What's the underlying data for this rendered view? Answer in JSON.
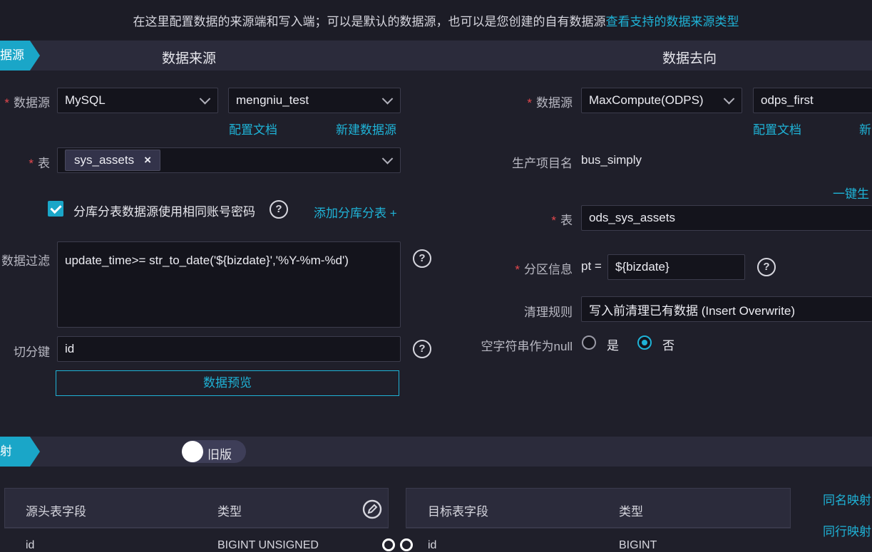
{
  "banner": {
    "text": "在这里配置数据的来源端和写入端；可以是默认的数据源，也可以是您创建的自有数据源",
    "link": "查看支持的数据来源类型"
  },
  "section1": {
    "tag": "据源",
    "source_title": "数据来源",
    "target_title": "数据去向"
  },
  "source": {
    "datasource_label": "数据源",
    "datasource_type": "MySQL",
    "datasource_name": "mengniu_test",
    "config_doc_link": "配置文档",
    "new_datasource_link": "新建数据源",
    "table_label": "表",
    "table_chip": "sys_assets",
    "chip_remove": "×",
    "same_account_label": "分库分表数据源使用相同账号密码",
    "add_shard_link": "添加分库分表 +",
    "filter_label": "数据过滤",
    "filter_value": "update_time>= str_to_date('${bizdate}','%Y-%m-%d')",
    "split_key_label": "切分键",
    "split_key_value": "id",
    "preview_button": "数据预览"
  },
  "target": {
    "datasource_label": "数据源",
    "datasource_type": "MaxCompute(ODPS)",
    "datasource_name": "odps_first",
    "config_doc_link": "配置文档",
    "new_datasource_link": "新",
    "project_label": "生产项目名",
    "project_value": "bus_simply",
    "one_click_link": "一键生",
    "table_label": "表",
    "table_value": "ods_sys_assets",
    "partition_label": "分区信息",
    "partition_prefix": "pt =",
    "partition_value": "${bizdate}",
    "clean_label": "清理规则",
    "clean_value": "写入前清理已有数据 (Insert Overwrite)",
    "null_label": "空字符串作为null",
    "null_yes": "是",
    "null_no": "否"
  },
  "section2": {
    "tag": "射",
    "toggle_label": "旧版"
  },
  "mapping": {
    "source_headers": [
      "源头表字段",
      "类型"
    ],
    "target_headers": [
      "目标表字段",
      "类型"
    ],
    "source_row": [
      "id",
      "BIGINT UNSIGNED"
    ],
    "target_row": [
      "id",
      "BIGINT"
    ],
    "same_name_link": "同名映射",
    "same_row_link": "同行映射"
  },
  "colors": {
    "accent": "#1aa6c8",
    "link": "#1fb3d7",
    "required": "#e5484d",
    "background": "#1f1f2a"
  }
}
